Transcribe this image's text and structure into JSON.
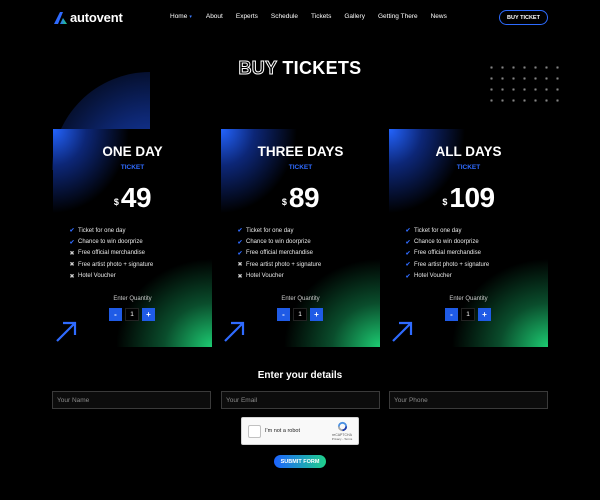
{
  "header": {
    "logo_text": "autovent",
    "nav": [
      {
        "label": "Home"
      },
      {
        "label": "About"
      },
      {
        "label": "Experts"
      },
      {
        "label": "Schedule"
      },
      {
        "label": "Tickets"
      },
      {
        "label": "Gallery"
      },
      {
        "label": "Getting There"
      },
      {
        "label": "News"
      }
    ],
    "buy_button": "BUY TICKET"
  },
  "page_title": {
    "outline": "BUY",
    "solid": "TICKETS"
  },
  "cards": [
    {
      "title": "ONE DAY",
      "subtitle": "TICKET",
      "currency": "$",
      "price": "49",
      "features": [
        {
          "text": "Ticket for one day",
          "mark": "✔"
        },
        {
          "text": "Chance to win doorprize",
          "mark": "✔"
        },
        {
          "text": "Free official merchandise",
          "mark": "✖"
        },
        {
          "text": "Free artist photo + signature",
          "mark": "✖"
        },
        {
          "text": "Hotel Voucher",
          "mark": "✖"
        }
      ],
      "qty_label": "Enter Quantity",
      "qty_value": "1",
      "minus": "-",
      "plus": "+"
    },
    {
      "title": "THREE DAYS",
      "subtitle": "TICKET",
      "currency": "$",
      "price": "89",
      "features": [
        {
          "text": "Ticket for one day",
          "mark": "✔"
        },
        {
          "text": "Chance to win doorprize",
          "mark": "✔"
        },
        {
          "text": "Free official merchandise",
          "mark": "✔"
        },
        {
          "text": "Free artist photo + signature",
          "mark": "✖"
        },
        {
          "text": "Hotel Voucher",
          "mark": "✖"
        }
      ],
      "qty_label": "Enter Quantity",
      "qty_value": "1",
      "minus": "-",
      "plus": "+"
    },
    {
      "title": "ALL DAYS",
      "subtitle": "TICKET",
      "currency": "$",
      "price": "109",
      "features": [
        {
          "text": "Ticket for one day",
          "mark": "✔"
        },
        {
          "text": "Chance to win doorprize",
          "mark": "✔"
        },
        {
          "text": "Free official merchandise",
          "mark": "✔"
        },
        {
          "text": "Free artist photo + signature",
          "mark": "✔"
        },
        {
          "text": "Hotel Voucher",
          "mark": "✔"
        }
      ],
      "qty_label": "Enter Quantity",
      "qty_value": "1",
      "minus": "-",
      "plus": "+"
    }
  ],
  "details": {
    "title": "Enter your details",
    "name_placeholder": "Your Name",
    "email_placeholder": "Your Email",
    "phone_placeholder": "Your Phone",
    "captcha_label": "I'm not a robot",
    "captcha_brand": "reCAPTCHA",
    "captcha_links": "Privacy - Terms",
    "submit": "SUBMIT FORM"
  },
  "colors": {
    "accent_blue": "#2f6bff",
    "accent_green": "#1ed07a",
    "background": "#000000"
  }
}
